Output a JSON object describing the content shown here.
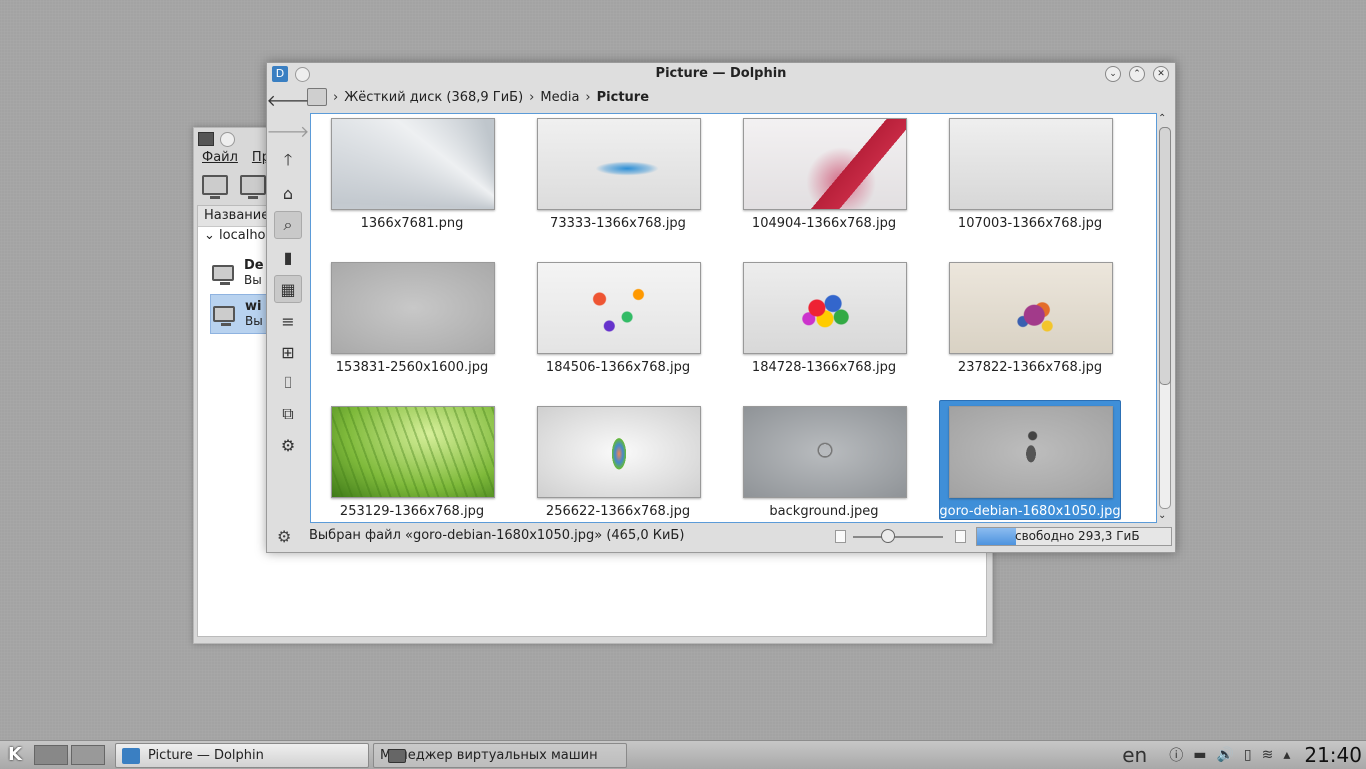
{
  "bg_window": {
    "menu": [
      "Файл",
      "Пр"
    ],
    "column_header": "Название",
    "connection": "localhost",
    "vms": [
      {
        "name": "De",
        "status": "Вы"
      },
      {
        "name": "wi",
        "status": "Вы"
      }
    ]
  },
  "dolphin": {
    "title": "Picture — Dolphin",
    "breadcrumb": [
      "Жёсткий диск (368,9 ГиБ)",
      "Media",
      "Picture"
    ],
    "files": [
      {
        "name": "1366x7681.png",
        "thumb": "light-rays"
      },
      {
        "name": "73333-1366x768.jpg",
        "thumb": "hydrant-splash"
      },
      {
        "name": "104904-1366x768.jpg",
        "thumb": "red-pencil"
      },
      {
        "name": "107003-1366x768.jpg",
        "thumb": "google-logo"
      },
      {
        "name": "153831-2560x1600.jpg",
        "thumb": "grey-text"
      },
      {
        "name": "184506-1366x768.jpg",
        "thumb": "color-shards"
      },
      {
        "name": "184728-1366x768.jpg",
        "thumb": "color-cubes"
      },
      {
        "name": "237822-1366x768.jpg",
        "thumb": "color-explosion"
      },
      {
        "name": "253129-1366x768.jpg",
        "thumb": "green-grass"
      },
      {
        "name": "256622-1366x768.jpg",
        "thumb": "pencil-cup"
      },
      {
        "name": "background.jpeg",
        "thumb": "debian-swirl"
      },
      {
        "name": "goro-debian-1680x1050.jpg",
        "thumb": "goro-debian",
        "selected": true
      }
    ],
    "status_message": "Выбран файл «goro-debian-1680x1050.jpg» (465,0 КиБ)",
    "free_space": "свободно 293,3 ГиБ",
    "free_space_used_fraction": 0.2,
    "zoom_level_fraction": 0.38,
    "scroll_position_fraction": 0.0
  },
  "taskbar": {
    "tasks": [
      {
        "label": "Picture — Dolphin",
        "active": true
      },
      {
        "label": "Менеджер виртуальных машин",
        "active": false
      }
    ],
    "language": "en",
    "clock": "21:40"
  },
  "colors": {
    "selection": "#3f8fd8",
    "accent": "#5b9bd8",
    "desktop": "#a3a3a3"
  }
}
